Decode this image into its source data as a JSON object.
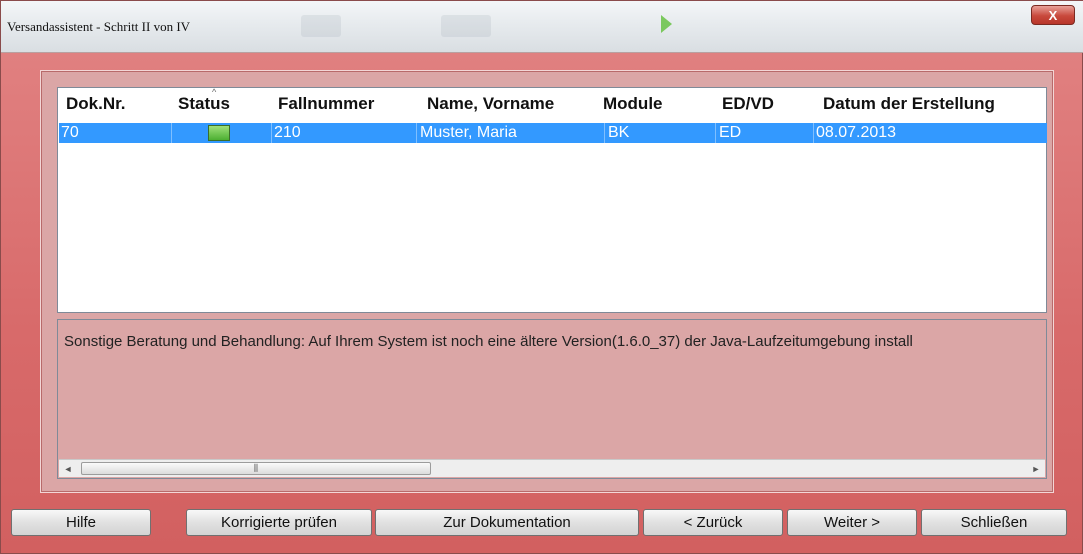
{
  "window": {
    "title": "Versandassistent - Schritt II von IV",
    "close_label": "X"
  },
  "grid": {
    "sort_indicator": "^",
    "columns": [
      "Dok.Nr.",
      "Status",
      "Fallnummer",
      "Name, Vorname",
      "Module",
      "ED/VD",
      "Datum der Erstellung"
    ],
    "rows": [
      {
        "dok_nr": "70",
        "status": "green",
        "fallnummer": "210",
        "name": "Muster, Maria",
        "module": "BK",
        "ed_vd": "ED",
        "datum": "08.07.2013"
      }
    ]
  },
  "message": {
    "text": "Sonstige Beratung und Behandlung: Auf Ihrem System ist noch eine ältere Version(1.6.0_37) der Java-Laufzeitumgebung install",
    "scroll_left": "◄",
    "scroll_right": "►",
    "scroll_thumb_grip": "⫼"
  },
  "buttons": {
    "hilfe": "Hilfe",
    "korrigierte_pruefen": "Korrigierte prüfen",
    "zur_dokumentation": "Zur Dokumentation",
    "zurueck": "< Zurück",
    "weiter": "Weiter >",
    "schliessen": "Schließen"
  },
  "colors": {
    "selection": "#3399ff",
    "status_ok": "#4caf32",
    "window_bg": "#d86a6a"
  }
}
